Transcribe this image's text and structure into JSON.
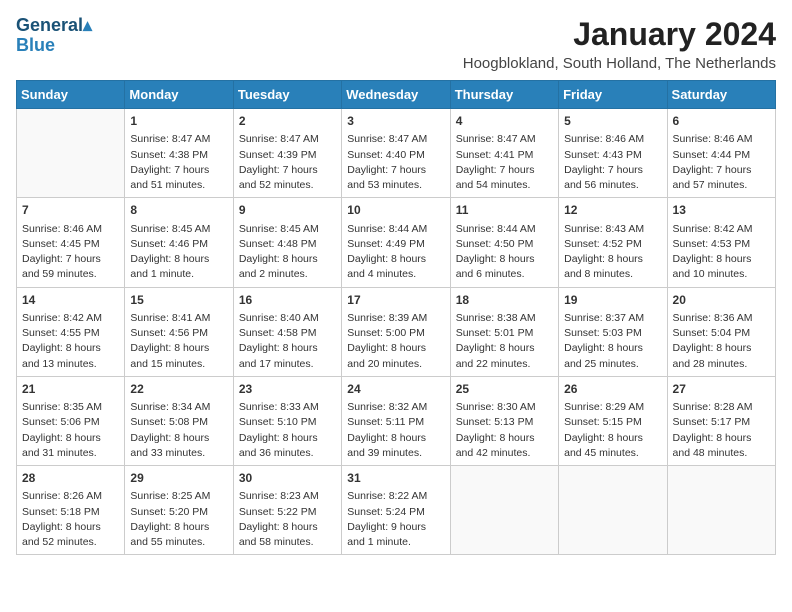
{
  "logo": {
    "line1": "General",
    "line2": "Blue"
  },
  "title": "January 2024",
  "location": "Hoogblokland, South Holland, The Netherlands",
  "weekdays": [
    "Sunday",
    "Monday",
    "Tuesday",
    "Wednesday",
    "Thursday",
    "Friday",
    "Saturday"
  ],
  "weeks": [
    [
      {
        "num": "",
        "sunrise": "",
        "sunset": "",
        "daylight": ""
      },
      {
        "num": "1",
        "sunrise": "Sunrise: 8:47 AM",
        "sunset": "Sunset: 4:38 PM",
        "daylight": "Daylight: 7 hours and 51 minutes."
      },
      {
        "num": "2",
        "sunrise": "Sunrise: 8:47 AM",
        "sunset": "Sunset: 4:39 PM",
        "daylight": "Daylight: 7 hours and 52 minutes."
      },
      {
        "num": "3",
        "sunrise": "Sunrise: 8:47 AM",
        "sunset": "Sunset: 4:40 PM",
        "daylight": "Daylight: 7 hours and 53 minutes."
      },
      {
        "num": "4",
        "sunrise": "Sunrise: 8:47 AM",
        "sunset": "Sunset: 4:41 PM",
        "daylight": "Daylight: 7 hours and 54 minutes."
      },
      {
        "num": "5",
        "sunrise": "Sunrise: 8:46 AM",
        "sunset": "Sunset: 4:43 PM",
        "daylight": "Daylight: 7 hours and 56 minutes."
      },
      {
        "num": "6",
        "sunrise": "Sunrise: 8:46 AM",
        "sunset": "Sunset: 4:44 PM",
        "daylight": "Daylight: 7 hours and 57 minutes."
      }
    ],
    [
      {
        "num": "7",
        "sunrise": "Sunrise: 8:46 AM",
        "sunset": "Sunset: 4:45 PM",
        "daylight": "Daylight: 7 hours and 59 minutes."
      },
      {
        "num": "8",
        "sunrise": "Sunrise: 8:45 AM",
        "sunset": "Sunset: 4:46 PM",
        "daylight": "Daylight: 8 hours and 1 minute."
      },
      {
        "num": "9",
        "sunrise": "Sunrise: 8:45 AM",
        "sunset": "Sunset: 4:48 PM",
        "daylight": "Daylight: 8 hours and 2 minutes."
      },
      {
        "num": "10",
        "sunrise": "Sunrise: 8:44 AM",
        "sunset": "Sunset: 4:49 PM",
        "daylight": "Daylight: 8 hours and 4 minutes."
      },
      {
        "num": "11",
        "sunrise": "Sunrise: 8:44 AM",
        "sunset": "Sunset: 4:50 PM",
        "daylight": "Daylight: 8 hours and 6 minutes."
      },
      {
        "num": "12",
        "sunrise": "Sunrise: 8:43 AM",
        "sunset": "Sunset: 4:52 PM",
        "daylight": "Daylight: 8 hours and 8 minutes."
      },
      {
        "num": "13",
        "sunrise": "Sunrise: 8:42 AM",
        "sunset": "Sunset: 4:53 PM",
        "daylight": "Daylight: 8 hours and 10 minutes."
      }
    ],
    [
      {
        "num": "14",
        "sunrise": "Sunrise: 8:42 AM",
        "sunset": "Sunset: 4:55 PM",
        "daylight": "Daylight: 8 hours and 13 minutes."
      },
      {
        "num": "15",
        "sunrise": "Sunrise: 8:41 AM",
        "sunset": "Sunset: 4:56 PM",
        "daylight": "Daylight: 8 hours and 15 minutes."
      },
      {
        "num": "16",
        "sunrise": "Sunrise: 8:40 AM",
        "sunset": "Sunset: 4:58 PM",
        "daylight": "Daylight: 8 hours and 17 minutes."
      },
      {
        "num": "17",
        "sunrise": "Sunrise: 8:39 AM",
        "sunset": "Sunset: 5:00 PM",
        "daylight": "Daylight: 8 hours and 20 minutes."
      },
      {
        "num": "18",
        "sunrise": "Sunrise: 8:38 AM",
        "sunset": "Sunset: 5:01 PM",
        "daylight": "Daylight: 8 hours and 22 minutes."
      },
      {
        "num": "19",
        "sunrise": "Sunrise: 8:37 AM",
        "sunset": "Sunset: 5:03 PM",
        "daylight": "Daylight: 8 hours and 25 minutes."
      },
      {
        "num": "20",
        "sunrise": "Sunrise: 8:36 AM",
        "sunset": "Sunset: 5:04 PM",
        "daylight": "Daylight: 8 hours and 28 minutes."
      }
    ],
    [
      {
        "num": "21",
        "sunrise": "Sunrise: 8:35 AM",
        "sunset": "Sunset: 5:06 PM",
        "daylight": "Daylight: 8 hours and 31 minutes."
      },
      {
        "num": "22",
        "sunrise": "Sunrise: 8:34 AM",
        "sunset": "Sunset: 5:08 PM",
        "daylight": "Daylight: 8 hours and 33 minutes."
      },
      {
        "num": "23",
        "sunrise": "Sunrise: 8:33 AM",
        "sunset": "Sunset: 5:10 PM",
        "daylight": "Daylight: 8 hours and 36 minutes."
      },
      {
        "num": "24",
        "sunrise": "Sunrise: 8:32 AM",
        "sunset": "Sunset: 5:11 PM",
        "daylight": "Daylight: 8 hours and 39 minutes."
      },
      {
        "num": "25",
        "sunrise": "Sunrise: 8:30 AM",
        "sunset": "Sunset: 5:13 PM",
        "daylight": "Daylight: 8 hours and 42 minutes."
      },
      {
        "num": "26",
        "sunrise": "Sunrise: 8:29 AM",
        "sunset": "Sunset: 5:15 PM",
        "daylight": "Daylight: 8 hours and 45 minutes."
      },
      {
        "num": "27",
        "sunrise": "Sunrise: 8:28 AM",
        "sunset": "Sunset: 5:17 PM",
        "daylight": "Daylight: 8 hours and 48 minutes."
      }
    ],
    [
      {
        "num": "28",
        "sunrise": "Sunrise: 8:26 AM",
        "sunset": "Sunset: 5:18 PM",
        "daylight": "Daylight: 8 hours and 52 minutes."
      },
      {
        "num": "29",
        "sunrise": "Sunrise: 8:25 AM",
        "sunset": "Sunset: 5:20 PM",
        "daylight": "Daylight: 8 hours and 55 minutes."
      },
      {
        "num": "30",
        "sunrise": "Sunrise: 8:23 AM",
        "sunset": "Sunset: 5:22 PM",
        "daylight": "Daylight: 8 hours and 58 minutes."
      },
      {
        "num": "31",
        "sunrise": "Sunrise: 8:22 AM",
        "sunset": "Sunset: 5:24 PM",
        "daylight": "Daylight: 9 hours and 1 minute."
      },
      {
        "num": "",
        "sunrise": "",
        "sunset": "",
        "daylight": ""
      },
      {
        "num": "",
        "sunrise": "",
        "sunset": "",
        "daylight": ""
      },
      {
        "num": "",
        "sunrise": "",
        "sunset": "",
        "daylight": ""
      }
    ]
  ]
}
